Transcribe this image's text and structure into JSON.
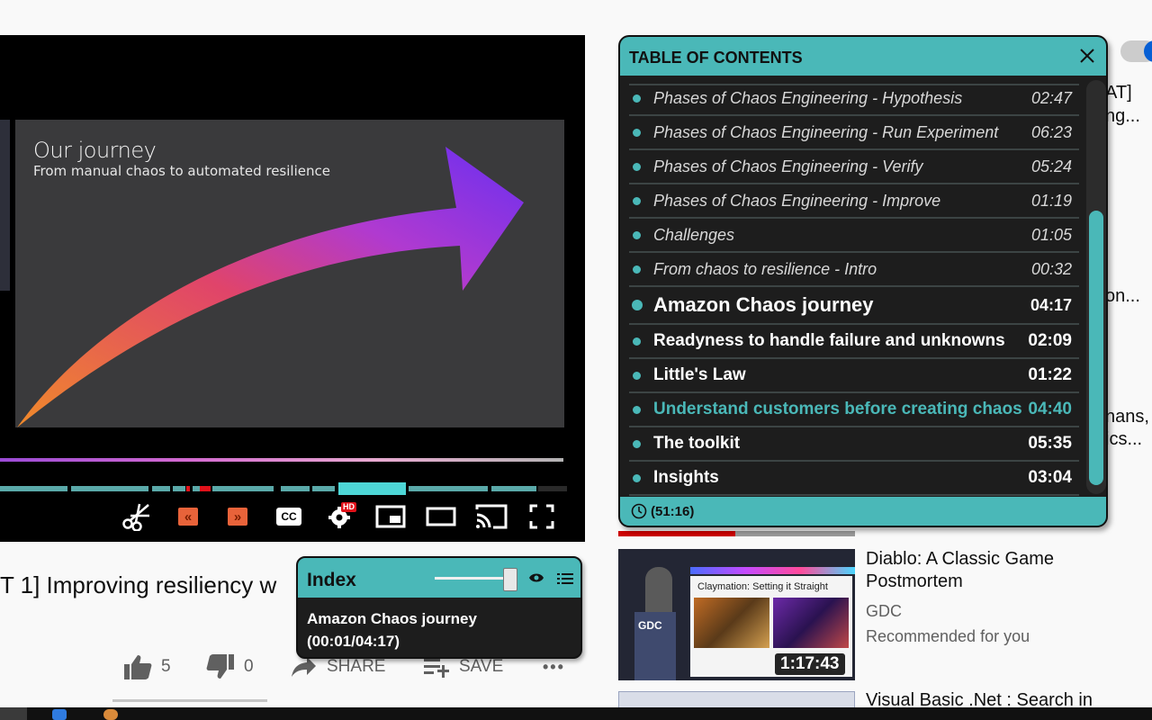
{
  "video": {
    "slide_title": "Our journey",
    "slide_subtitle": "From manual chaos to automated resilience",
    "title": "T 1] Improving resiliency w",
    "controls": {
      "clip_icon": "scissors-icon",
      "prev_chapter": "«",
      "next_chapter": "»",
      "cc": "CC",
      "hd_badge": "HD"
    }
  },
  "actions": {
    "like_count": "5",
    "dislike_count": "0",
    "share_label": "SHARE",
    "save_label": "SAVE",
    "more_label": "•••"
  },
  "toc": {
    "title": "TABLE OF CONTENTS",
    "total_duration": "(51:16)",
    "items": [
      {
        "label": "Phases of Chaos Engineering - Hypothesis",
        "time": "02:47"
      },
      {
        "label": "Phases of Chaos Engineering - Run Experiment",
        "time": "06:23"
      },
      {
        "label": "Phases of Chaos Engineering - Verify",
        "time": "05:24"
      },
      {
        "label": "Phases of Chaos Engineering - Improve",
        "time": "01:19"
      },
      {
        "label": "Challenges",
        "time": "01:05"
      },
      {
        "label": "From chaos to resilience - Intro",
        "time": "00:32"
      },
      {
        "label": "Amazon Chaos journey",
        "time": "04:17"
      },
      {
        "label": "Readyness to handle failure and unknowns",
        "time": "02:09"
      },
      {
        "label": "Little's Law",
        "time": "01:22"
      },
      {
        "label": "Understand customers before creating chaos",
        "time": "04:40"
      },
      {
        "label": "The toolkit",
        "time": "05:35"
      },
      {
        "label": "Insights",
        "time": "03:04"
      }
    ]
  },
  "index_panel": {
    "title": "Index",
    "chapter": "Amazon Chaos journey",
    "progress": "(00:01/04:17)"
  },
  "sidebar": {
    "peek_texts": [
      "AT]",
      "ng...",
      "on...",
      "nans,",
      "ics..."
    ],
    "recommendations": [
      {
        "title": "Diablo: A Classic Game Postmortem",
        "channel": "GDC",
        "meta": "Recommended for you",
        "duration": "1:17:43",
        "thumb_caption": "Claymation: Setting it Straight",
        "thumb_logo": "GDC"
      },
      {
        "title": "Visual Basic .Net : Search in"
      }
    ]
  },
  "colors": {
    "accent": "#4ab8b8",
    "panel_bg": "#1d1d1d",
    "youtube_red": "#e0111a"
  }
}
